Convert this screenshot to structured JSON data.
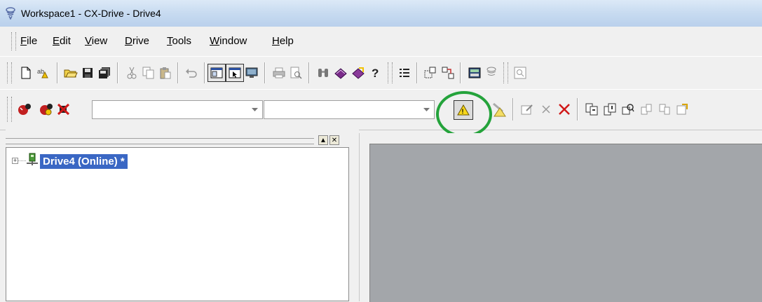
{
  "window": {
    "title": "Workspace1 - CX-Drive - Drive4"
  },
  "menu": [
    "File",
    "Edit",
    "View",
    "Drive",
    "Tools",
    "Window",
    "Help"
  ],
  "toolbar1": {
    "icons": [
      "new-document-icon",
      "find-replace-icon",
      "open-folder-icon",
      "save-icon",
      "save-all-icon",
      "cut-icon",
      "copy-icon",
      "paste-icon",
      "undo-icon",
      "window-layout-icon",
      "window-pointer-icon",
      "monitor-icon",
      "print-icon",
      "print-preview-icon",
      "binoculars-icon",
      "help-book-icon",
      "help-book-arrow-icon",
      "whats-this-help-icon",
      "list-icon",
      "select-icon",
      "compare-icon",
      "calculator-icon",
      "sensor-icon",
      "zoom-icon"
    ]
  },
  "toolbar2": {
    "icons": [
      "go-online-icon",
      "work-online-icon",
      "disconnect-icon",
      "warning-icon",
      "warning-arrow-icon",
      "edit-parameter-icon",
      "delete-gray-icon",
      "delete-red-icon",
      "transfer-to-drive-icon",
      "transfer-from-drive-icon",
      "compare-parameters-icon",
      "upload-icon",
      "download-icon",
      "export-icon"
    ],
    "combo1_value": "",
    "combo2_value": ""
  },
  "project_tree": {
    "nodes": [
      {
        "label": "Drive4 (Online) *",
        "expander": "+"
      }
    ]
  },
  "colors": {
    "highlight_circle": "#24a33b",
    "selection": "#3a67c4",
    "mdi_background": "#a3a6aa"
  }
}
